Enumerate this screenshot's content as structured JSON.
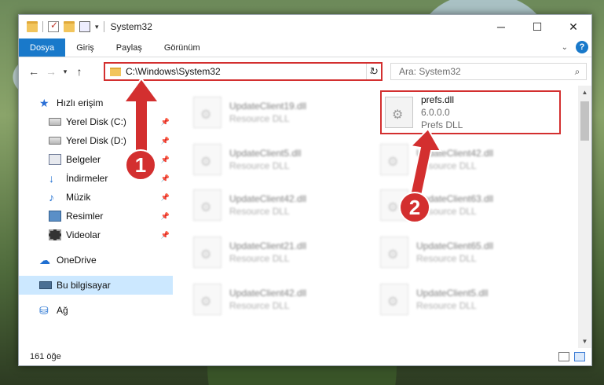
{
  "window": {
    "title": "System32",
    "controls": [
      "minimize",
      "maximize",
      "close"
    ]
  },
  "ribbon": {
    "tabs": [
      "Dosya",
      "Giriş",
      "Paylaş",
      "Görünüm"
    ],
    "help": "?"
  },
  "address": {
    "path": "C:\\Windows\\System32",
    "search_placeholder": "Ara: System32"
  },
  "nav": {
    "items": [
      {
        "label": "Hızlı erişim",
        "icon": "star-icon"
      },
      {
        "label": "Yerel Disk (C:)",
        "icon": "drive-icon",
        "pinned": true
      },
      {
        "label": "Yerel Disk (D:)",
        "icon": "drive-icon",
        "pinned": true
      },
      {
        "label": "Belgeler",
        "icon": "documents-icon",
        "pinned": true
      },
      {
        "label": "İndirmeler",
        "icon": "download-icon",
        "pinned": true
      },
      {
        "label": "Müzik",
        "icon": "music-icon",
        "pinned": true
      },
      {
        "label": "Resimler",
        "icon": "pictures-icon",
        "pinned": true
      },
      {
        "label": "Videolar",
        "icon": "videos-icon",
        "pinned": true
      },
      {
        "label": "OneDrive",
        "icon": "cloud-icon"
      },
      {
        "label": "Bu bilgisayar",
        "icon": "computer-icon",
        "selected": true
      },
      {
        "label": "Ağ",
        "icon": "network-icon"
      }
    ]
  },
  "files": {
    "highlight": {
      "name": "prefs.dll",
      "version": "6.0.0.0",
      "desc": "Prefs DLL"
    },
    "left": [
      {
        "name": "UpdateClient19.dll",
        "desc": "Resource DLL"
      },
      {
        "name": "UpdateClient5.dll",
        "desc": "Resource DLL"
      },
      {
        "name": "UpdateClient42.dll",
        "desc": "Resource DLL"
      },
      {
        "name": "UpdateClient21.dll",
        "desc": "Resource DLL"
      },
      {
        "name": "UpdateClient42.dll",
        "desc": "Resource DLL"
      }
    ],
    "right": [
      {
        "name": "UpdateClient42.dll",
        "desc": "Resource DLL"
      },
      {
        "name": "UpdateClient63.dll",
        "desc": "Resource DLL"
      },
      {
        "name": "UpdateClient65.dll",
        "desc": "Resource DLL"
      },
      {
        "name": "UpdateClient5.dll",
        "desc": "Resource DLL"
      }
    ]
  },
  "status": {
    "count": "161 öğe"
  },
  "callouts": {
    "one": "1",
    "two": "2",
    "color": "#d32f2f"
  }
}
